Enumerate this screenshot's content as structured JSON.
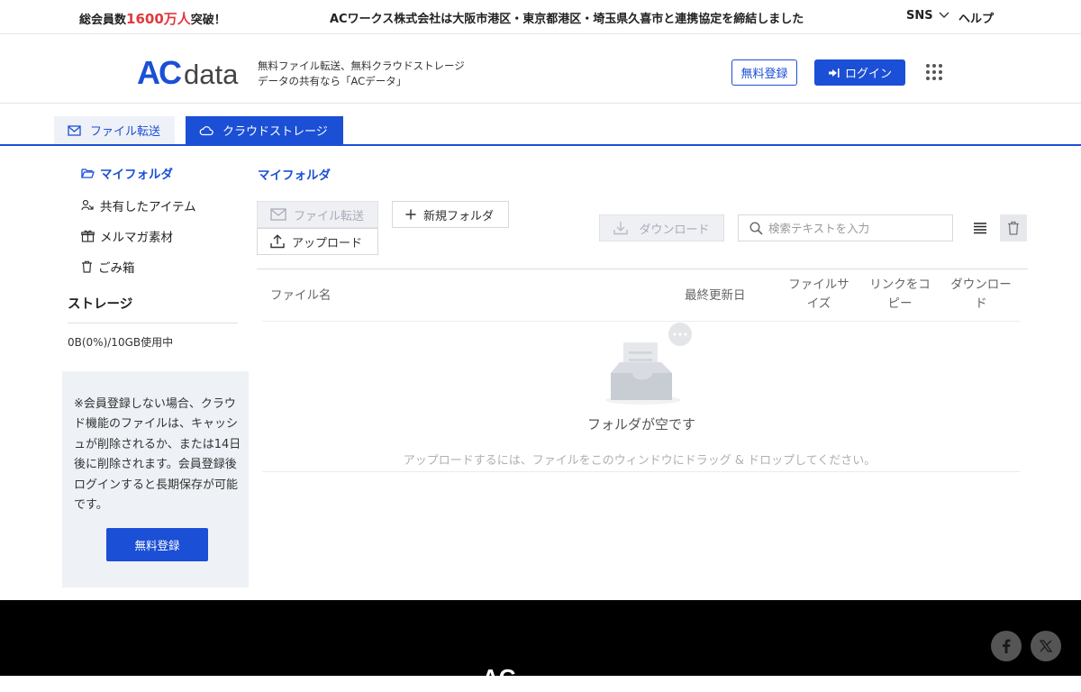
{
  "topbar": {
    "members_prefix": "総会員数",
    "members_count": "1600万人",
    "members_suffix": "突破！",
    "news": "ACワークス株式会社は大阪市港区・東京都港区・埼玉県久喜市と連携協定を締結しました",
    "sns_label": "SNS",
    "help_label": "ヘルプ"
  },
  "header": {
    "logo_ac": "AC",
    "logo_data": "data",
    "tagline_line1": "無料ファイル転送、無料クラウドストレージ",
    "tagline_line2": "データの共有なら「ACデータ」",
    "register_label": "無料登録",
    "login_label": "ログイン"
  },
  "tabs": [
    {
      "label": "ファイル転送",
      "active": false
    },
    {
      "label": "クラウドストレージ",
      "active": true
    }
  ],
  "sidebar": {
    "items": [
      {
        "label": "マイフォルダ",
        "active": true
      },
      {
        "label": "共有したアイテム",
        "active": false
      },
      {
        "label": "メルマガ素材",
        "active": false
      },
      {
        "label": "ごみ箱",
        "active": false
      }
    ],
    "storage_title": "ストレージ",
    "storage_usage": "0B(0%)/10GB使用中",
    "notice_text": "※会員登録しない場合、クラウド機能のファイルは、キャッシュが削除されるか、または14日後に削除されます。会員登録後ログインすると長期保存が可能です。",
    "notice_button": "無料登録"
  },
  "main": {
    "title": "マイフォルダ",
    "toolbar": {
      "transfer_label": "ファイル転送",
      "new_folder_label": "新規フォルダ",
      "upload_label": "アップロード",
      "download_label": "ダウンロード",
      "search_placeholder": "検索テキストを入力"
    },
    "columns": {
      "name": "ファイル名",
      "modified": "最終更新日",
      "size": "ファイルサイズ",
      "copy_link": "リンクをコピー",
      "download": "ダウンロード"
    },
    "empty_title": "フォルダが空です",
    "empty_hint": "アップロードするには、ファイルをこのウィンドウにドラッグ & ドロップしてください。"
  },
  "footer": {
    "logo": "AC"
  },
  "colors": {
    "brand_blue": "#1b4fd6",
    "members_red": "#e0393e"
  }
}
